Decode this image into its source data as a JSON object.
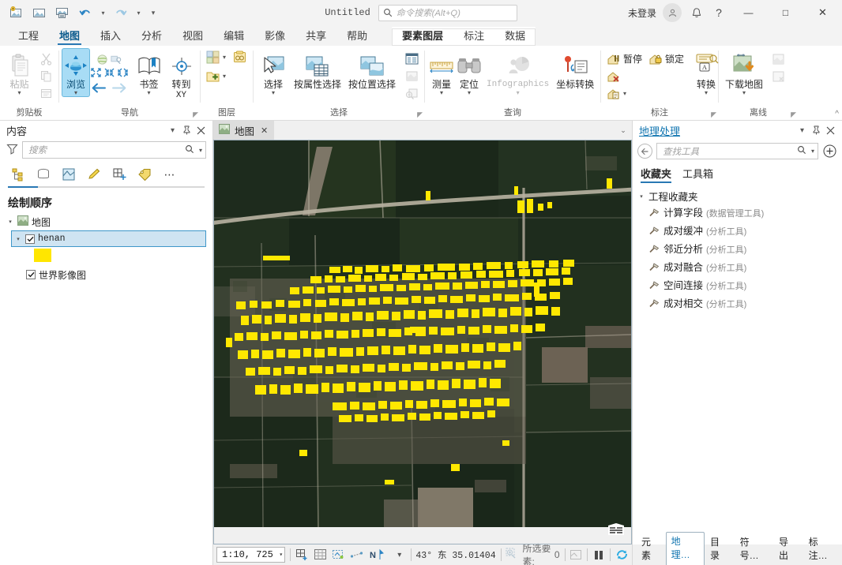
{
  "titlebar": {
    "quick_access": [
      {
        "name": "new-project-icon",
        "label": "新建工程"
      },
      {
        "name": "open-project-icon",
        "label": "打开工程"
      },
      {
        "name": "save-project-icon",
        "label": "保存工程"
      },
      {
        "name": "undo-icon",
        "label": "撤销"
      },
      {
        "name": "redo-icon",
        "label": "重做"
      },
      {
        "name": "customize-qat-icon",
        "label": "自定义快速访问工具栏"
      }
    ],
    "doc_title": "Untitled",
    "command_search_placeholder": "命令搜索(Alt+Q)",
    "sign_in": "未登录",
    "window_buttons": {
      "minimize": "—",
      "maximize": "□",
      "close": "✕"
    }
  },
  "ribbon": {
    "tabs": [
      "工程",
      "地图",
      "插入",
      "分析",
      "视图",
      "编辑",
      "影像",
      "共享",
      "帮助"
    ],
    "active_tab": "地图",
    "contextual_tabs": [
      "要素图层",
      "标注",
      "数据"
    ],
    "contextual_selected": "要素图层",
    "groups": [
      {
        "title": "剪贴板",
        "big": [
          {
            "label": "粘贴",
            "caret": true,
            "icon": "paste-icon",
            "disabled": true
          }
        ],
        "small": [
          {
            "label": "",
            "icon": "cut-icon",
            "disabled": true
          },
          {
            "label": "",
            "icon": "copy-icon",
            "disabled": true
          },
          {
            "label": "",
            "icon": "copy-path-icon",
            "disabled": true
          }
        ]
      },
      {
        "title": "导航",
        "big": [
          {
            "label": "浏览",
            "caret": true,
            "icon": "explore-icon",
            "active": true
          },
          {
            "label": "书签",
            "caret": true,
            "icon": "bookmarks-icon"
          },
          {
            "label": "转到 XY",
            "caret": false,
            "icon": "goto-xy-icon"
          }
        ],
        "small": [
          {
            "label": "",
            "icon": "globe-icon",
            "disabled": true
          },
          {
            "label": "",
            "icon": "fixed-zoom-icon",
            "disabled": true
          }
        ],
        "has_launcher": true
      },
      {
        "title": "图层",
        "small": [
          {
            "label": "",
            "icon": "basemap-icon",
            "caret": true
          },
          {
            "label": "",
            "icon": "add-data-icon",
            "caret": true
          },
          {
            "label": "",
            "icon": "add-preset-icon"
          }
        ]
      },
      {
        "title": "选择",
        "big": [
          {
            "label": "选择",
            "caret": true,
            "icon": "select-icon"
          },
          {
            "label": "按属性选择",
            "icon": "select-by-attributes-icon"
          },
          {
            "label": "按位置选择",
            "icon": "select-by-location-icon"
          }
        ],
        "small": [
          {
            "label": "",
            "icon": "attribute-table-icon"
          },
          {
            "label": "",
            "icon": "clear-selection-icon",
            "disabled": true
          },
          {
            "label": "",
            "icon": "zoom-to-selection-icon",
            "disabled": true
          }
        ],
        "has_launcher": true
      },
      {
        "title": "查询",
        "big": [
          {
            "label": "测量",
            "caret": true,
            "icon": "measure-icon"
          },
          {
            "label": "定位",
            "caret": true,
            "icon": "locate-icon"
          },
          {
            "label": "Infographics",
            "caret": true,
            "icon": "infographics-icon",
            "disabled": true
          },
          {
            "label": "坐标转换",
            "icon": "coordinate-conversion-icon"
          }
        ]
      },
      {
        "title": "标注",
        "small": [
          {
            "label": "暂停",
            "icon": "pause-labeling-icon"
          },
          {
            "label": "锁定",
            "icon": "lock-labeling-icon"
          },
          {
            "label": "",
            "icon": "unplaced-labels-icon"
          },
          {
            "label": "",
            "icon": "view-unplaced-icon",
            "caret": true
          }
        ],
        "big": [
          {
            "label": "转换",
            "caret": true,
            "icon": "convert-labels-icon"
          }
        ],
        "has_launcher": true
      },
      {
        "title": "离线",
        "big": [
          {
            "label": "下载地图",
            "caret": true,
            "icon": "download-map-icon"
          }
        ],
        "small": [
          {
            "label": "",
            "icon": "sync-icon",
            "disabled": true
          },
          {
            "label": "",
            "icon": "remove-offline-icon",
            "disabled": true
          }
        ],
        "has_launcher": true
      }
    ]
  },
  "contents_panel": {
    "title": "内容",
    "search_placeholder": "搜索",
    "tab_icons": [
      "drawing-order-icon",
      "data-source-icon",
      "selection-icon",
      "editing-icon",
      "snapping-icon",
      "labeling-icon",
      "more-options-icon"
    ],
    "section_title": "绘制顺序",
    "tree": [
      {
        "label": "地图",
        "type": "map",
        "indent": 0,
        "expanded": true,
        "icon": "map-icon"
      },
      {
        "label": "henan",
        "type": "layer",
        "indent": 1,
        "expanded": true,
        "checked": true,
        "selected": true,
        "mono": true
      },
      {
        "label": "",
        "type": "symbol",
        "indent": 2,
        "swatch": "#ffe600"
      },
      {
        "label": "世界影像图",
        "type": "layer",
        "indent": 1,
        "checked": true
      }
    ]
  },
  "map_view": {
    "tab_label": "地图",
    "tab_close": "✕",
    "overflow_caret": "⌄"
  },
  "status_bar": {
    "scale": "1:10, 725",
    "scale_caret": "▾",
    "tools": [
      "zoom-to-extent-icon",
      "grid-icon",
      "selection-tool-icon",
      "measure-tool-icon",
      "north-arrow-icon"
    ],
    "coordinates": "43° 东 35.01404",
    "selected_features_label": "所选要素:",
    "selected_features_count": "0",
    "draw_status_icons": [
      "draw-pause-icon",
      "pause-drawing-icon",
      "refresh-icon"
    ]
  },
  "geoprocessing_panel": {
    "title": "地理处理",
    "search_placeholder": "查找工具",
    "tabs": [
      "收藏夹",
      "工具箱"
    ],
    "active_tab": "收藏夹",
    "root_node": "工程收藏夹",
    "tools": [
      {
        "name": "计算字段",
        "toolbox": "(数据管理工具)"
      },
      {
        "name": "成对缓冲",
        "toolbox": "(分析工具)"
      },
      {
        "name": "邻近分析",
        "toolbox": "(分析工具)"
      },
      {
        "name": "成对融合",
        "toolbox": "(分析工具)"
      },
      {
        "name": "空间连接",
        "toolbox": "(分析工具)"
      },
      {
        "name": "成对相交",
        "toolbox": "(分析工具)"
      }
    ]
  },
  "dock_tabs": {
    "items": [
      "元素",
      "地理…",
      "目录",
      "符号…",
      "导出",
      "标注…"
    ],
    "active": "地理…"
  },
  "colors": {
    "accent": "#2978b4",
    "highlight_fill": "#ffe600",
    "selected_row": "#cfe4f2",
    "ribbon_active": "#a8dcf5",
    "link": "#1175b0"
  }
}
